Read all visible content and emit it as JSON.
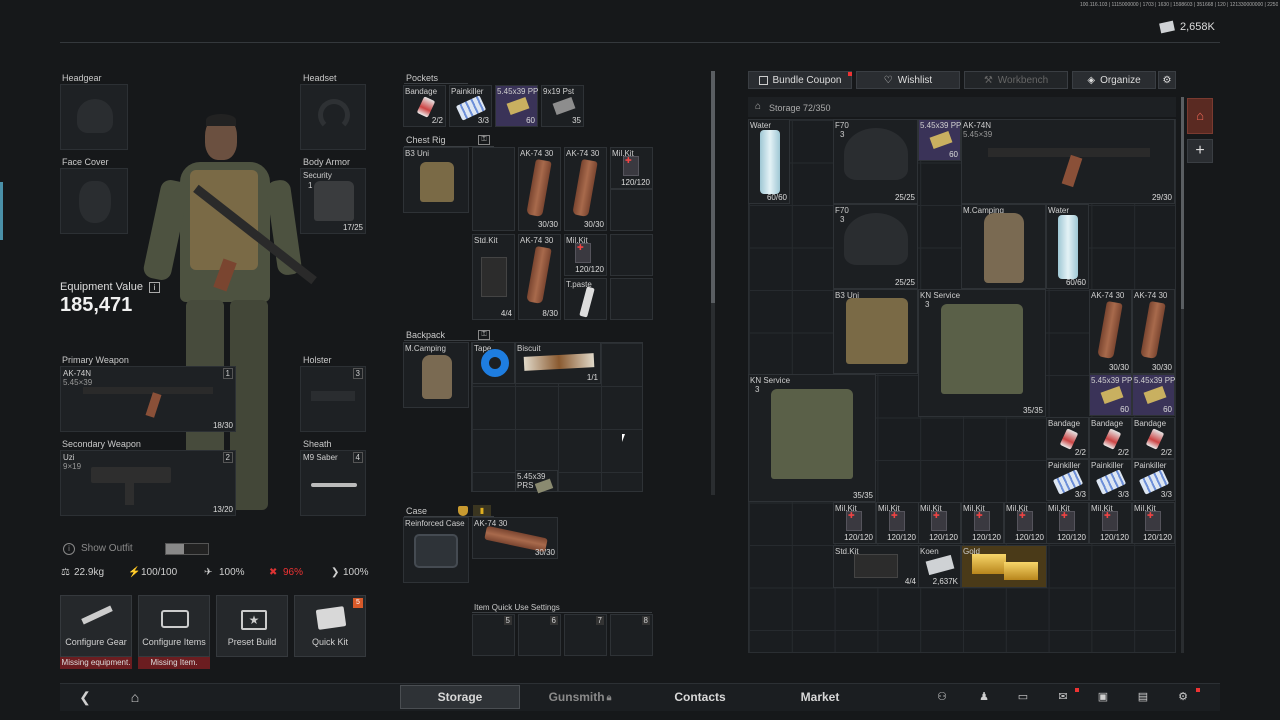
{
  "header": {
    "build_info": "100.116.103 | 1115000000 | 1703 | 1630 | 1598603 | 351668 | 120 | 121330000000 | 2250 | 2K | 1440",
    "currency": "2,658K",
    "currency_icon": "cash-icon"
  },
  "equipment": {
    "headgear": "Headgear",
    "headset": "Headset",
    "face_cover": "Face Cover",
    "body_armor": {
      "label": "Body Armor",
      "name": "Security",
      "armor_class": "1",
      "durability": "17/25"
    },
    "value_label": "Equipment Value",
    "value": "185,471",
    "primary": {
      "label": "Primary Weapon",
      "name": "AK-74N",
      "caliber": "5.45×39",
      "slot": "1",
      "ammo": "18/30"
    },
    "holster": {
      "label": "Holster",
      "slot": "3"
    },
    "secondary": {
      "label": "Secondary Weapon",
      "name": "Uzi",
      "caliber": "9×19",
      "slot": "2",
      "ammo": "13/20"
    },
    "sheath": {
      "label": "Sheath",
      "name": "M9 Saber",
      "slot": "4"
    },
    "show_outfit": "Show Outfit",
    "stats": {
      "weight": "22.9kg",
      "energy": "100/100",
      "hydration": "100%",
      "health": "96%",
      "stamina": "100%"
    },
    "buttons": [
      {
        "label": "Configure Gear",
        "warning": "Missing equipment."
      },
      {
        "label": "Configure Items",
        "warning": "Missing Item."
      },
      {
        "label": "Preset Build"
      },
      {
        "label": "Quick Kit",
        "badge": "5"
      }
    ]
  },
  "containers": {
    "pockets": {
      "label": "Pockets",
      "items": [
        {
          "name": "Bandage",
          "count": "2/2"
        },
        {
          "name": "Painkiller",
          "count": "3/3"
        },
        {
          "name": "5.45x39 PP",
          "count": "60"
        },
        {
          "name": "9x19 Pst",
          "count": "35"
        }
      ]
    },
    "chest_rig": {
      "label": "Chest Rig",
      "name": "B3 Uni",
      "items": [
        {
          "name": "AK-74 30",
          "count": "30/30"
        },
        {
          "name": "AK-74 30",
          "count": "30/30"
        },
        {
          "name": "Mil.Kit",
          "count": "120/120"
        },
        {
          "name": "Std.Kit",
          "count": "4/4"
        },
        {
          "name": "AK-74 30",
          "count": "8/30"
        },
        {
          "name": "Mil.Kit",
          "count": "120/120"
        },
        {
          "name": "T.paste",
          "count": ""
        }
      ]
    },
    "backpack": {
      "label": "Backpack",
      "name": "M.Camping",
      "items": [
        {
          "name": "Tape",
          "count": ""
        },
        {
          "name": "Biscuit",
          "count": "1/1"
        },
        {
          "name": "5.45x39 PRS",
          "count": ""
        }
      ]
    },
    "case": {
      "label": "Case",
      "name": "Reinforced Case",
      "items": [
        {
          "name": "AK-74 30",
          "count": "30/30"
        }
      ]
    },
    "quick_use": {
      "label": "Item Quick Use Settings",
      "slots": [
        "5",
        "6",
        "7",
        "8"
      ]
    }
  },
  "storage": {
    "tabs": {
      "bundle": "Bundle Coupon",
      "wishlist": "Wishlist",
      "workbench": "Workbench",
      "organize": "Organize"
    },
    "title": "Storage 72/350",
    "items": {
      "water1": {
        "name": "Water",
        "count": "60/60"
      },
      "f70a": {
        "name": "F70",
        "cls": "3",
        "count": "25/25"
      },
      "ammo1": {
        "name": "5.45x39 PP",
        "count": "60"
      },
      "ak": {
        "name": "AK-74N",
        "sub": "5.45×39",
        "count": "29/30"
      },
      "f70b": {
        "name": "F70",
        "cls": "3",
        "count": "25/25"
      },
      "mcamp": {
        "name": "M.Camping",
        "count": ""
      },
      "water2": {
        "name": "Water",
        "count": "60/60"
      },
      "b3": {
        "name": "B3 Uni",
        "count": ""
      },
      "kn1": {
        "name": "KN Service",
        "cls": "3",
        "count": "35/35"
      },
      "mag1": {
        "name": "AK-74 30",
        "count": "30/30"
      },
      "mag2": {
        "name": "AK-74 30",
        "count": "30/30"
      },
      "kn2": {
        "name": "KN Service",
        "cls": "3",
        "count": "35/35"
      },
      "ammo2": {
        "name": "5.45x39 PP",
        "count": "60"
      },
      "ammo3": {
        "name": "5.45x39 PP",
        "count": "60"
      },
      "band1": {
        "name": "Bandage",
        "count": "2/2"
      },
      "band2": {
        "name": "Bandage",
        "count": "2/2"
      },
      "band3": {
        "name": "Bandage",
        "count": "2/2"
      },
      "pk1": {
        "name": "Painkiller",
        "count": "3/3"
      },
      "pk2": {
        "name": "Painkiller",
        "count": "3/3"
      },
      "pk3": {
        "name": "Painkiller",
        "count": "3/3"
      },
      "mk1": {
        "name": "Mil.Kit",
        "count": "120/120"
      },
      "mk2": {
        "name": "Mil.Kit",
        "count": "120/120"
      },
      "mk3": {
        "name": "Mil.Kit",
        "count": "120/120"
      },
      "mk4": {
        "name": "Mil.Kit",
        "count": "120/120"
      },
      "mk5": {
        "name": "Mil.Kit",
        "count": "120/120"
      },
      "mk6": {
        "name": "Mil.Kit",
        "count": "120/120"
      },
      "mk7": {
        "name": "Mil.Kit",
        "count": "120/120"
      },
      "mk8": {
        "name": "Mil.Kit",
        "count": "120/120"
      },
      "std": {
        "name": "Std.Kit",
        "count": "4/4"
      },
      "koen": {
        "name": "Koen",
        "count": "2,637K"
      },
      "gold": {
        "name": "Gold",
        "count": ""
      }
    }
  },
  "nav": {
    "tabs": [
      "Storage",
      "Gunsmith",
      "Contacts",
      "Market"
    ],
    "active": "Storage"
  }
}
